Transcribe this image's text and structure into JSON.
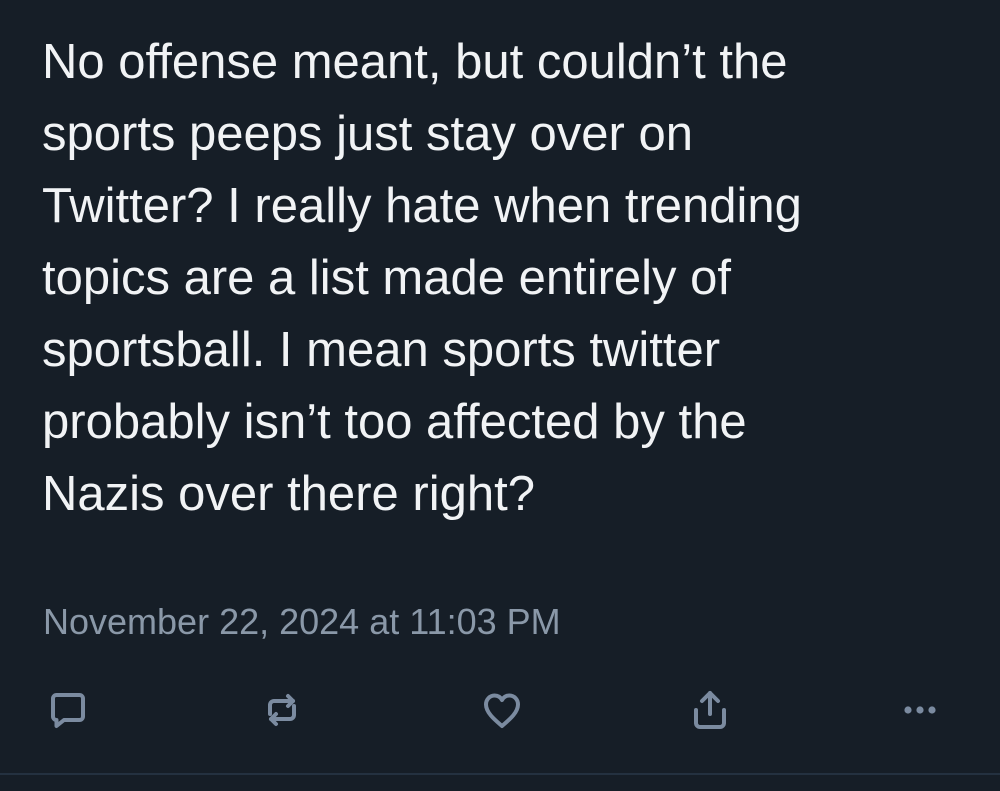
{
  "post": {
    "text_lines": [
      "No offense meant, but couldn’t the",
      "sports peeps just stay over on",
      "Twitter? I really hate when trending",
      "topics are a list made entirely of",
      "sportsball. I mean sports twitter",
      "probably isn’t too affected by the",
      "Nazis over there right?"
    ],
    "timestamp": "November 22, 2024 at 11:03 PM"
  },
  "actions": {
    "reply_icon": "reply-icon",
    "repost_icon": "repost-icon",
    "like_icon": "heart-icon",
    "share_icon": "share-icon",
    "more_icon": "more-options-icon"
  },
  "colors": {
    "background": "#161e27",
    "text": "#f1f3f5",
    "timestamp": "#8a98a8",
    "icon": "#7b8ba0"
  }
}
